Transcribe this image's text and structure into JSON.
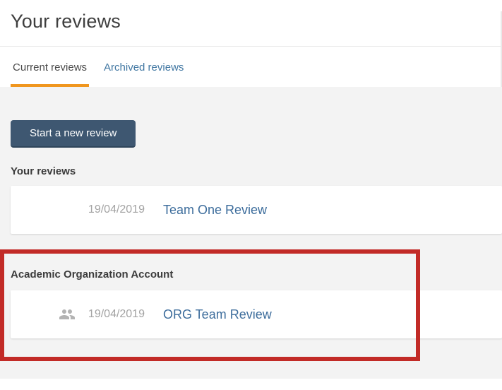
{
  "page": {
    "title": "Your reviews"
  },
  "tabs": {
    "current": {
      "label": "Current reviews",
      "active": true
    },
    "archived": {
      "label": "Archived reviews",
      "active": false
    }
  },
  "toolbar": {
    "start_review_label": "Start a new review"
  },
  "sections": {
    "personal": {
      "heading": "Your reviews",
      "rows": [
        {
          "date": "19/04/2019",
          "title": "Team One Review"
        }
      ]
    },
    "organization": {
      "heading": "Academic Organization Account",
      "highlighted": true,
      "rows": [
        {
          "date": "19/04/2019",
          "title": "ORG Team Review",
          "icon": "group-icon"
        }
      ]
    }
  },
  "colors": {
    "accent_orange": "#f0961e",
    "tab_link_blue": "#4177a2",
    "row_link_blue": "#3d6d9c",
    "button_navy": "#3e5771",
    "highlight_red": "#c22b27",
    "content_background": "#f3f3f3",
    "date_gray": "#a3a3a3",
    "icon_gray": "#b3b3b3"
  }
}
